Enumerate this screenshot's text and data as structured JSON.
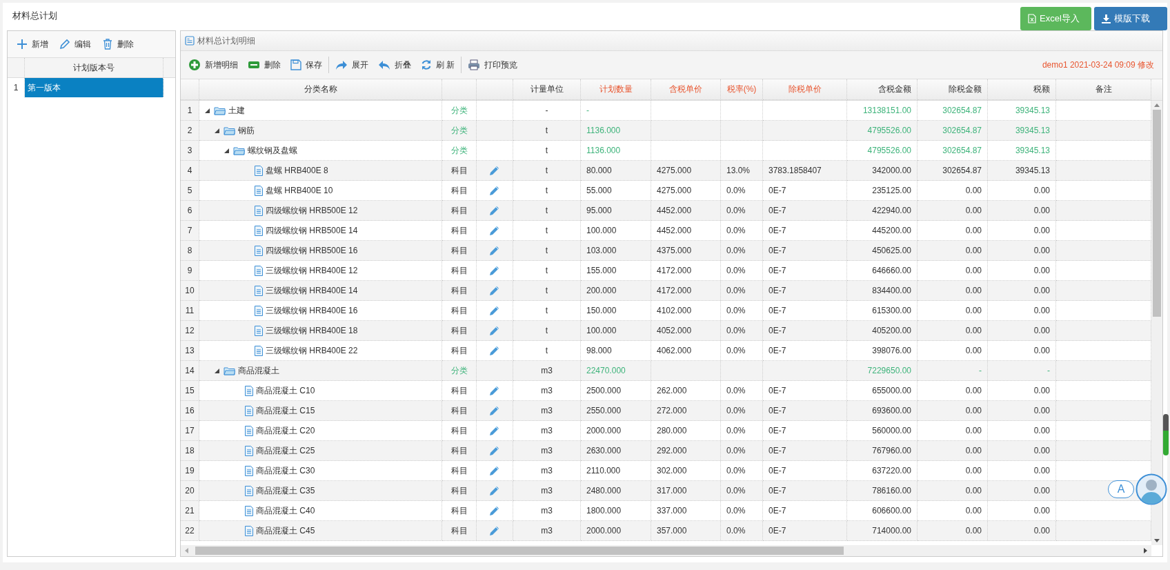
{
  "page": {
    "title": "材料总计划"
  },
  "header_buttons": [
    {
      "kind": "excel",
      "label": "Excel导入"
    },
    {
      "kind": "download",
      "label": "模版下载"
    }
  ],
  "versions_panel": {
    "toolbar": [
      {
        "kind": "add",
        "label": "新增"
      },
      {
        "kind": "edit",
        "label": "编辑"
      },
      {
        "kind": "delete",
        "label": "删除"
      }
    ],
    "column": "计划版本号",
    "rows": [
      {
        "num": "1",
        "name": "第一版本",
        "selected": true
      }
    ]
  },
  "detail_panel": {
    "title": "材料总计划明细",
    "toolbar": [
      {
        "kind": "add",
        "label": "新增明细"
      },
      {
        "kind": "remove",
        "label": "删除"
      },
      {
        "kind": "save",
        "label": "保存"
      },
      {
        "kind": "expand",
        "label": "展开"
      },
      {
        "kind": "collapse",
        "label": "折叠"
      },
      {
        "kind": "refresh",
        "label": "刷 新"
      },
      {
        "kind": "print",
        "label": "打印预览"
      }
    ],
    "modified_note": "demo1 2021-03-24 09:09 修改",
    "columns": [
      {
        "label": "分类名称",
        "editable": false
      },
      {
        "label": "计量单位",
        "editable": false
      },
      {
        "label": "计划数量",
        "editable": true
      },
      {
        "label": "含税单价",
        "editable": true
      },
      {
        "label": "税率(%)",
        "editable": true
      },
      {
        "label": "除税单价",
        "editable": true
      },
      {
        "label": "含税金额",
        "editable": false
      },
      {
        "label": "除税金额",
        "editable": false
      },
      {
        "label": "税额",
        "editable": false
      },
      {
        "label": "备注",
        "editable": false
      }
    ],
    "rows": [
      {
        "num": "1",
        "name": "土建",
        "kind": "category",
        "type": "分类",
        "expanded": true,
        "unit": "-",
        "qty": "-",
        "total": "13138151.00",
        "excl": "302654.87",
        "tax": "39345.13",
        "children": [
          {
            "num": "2",
            "name": "钢筋",
            "kind": "category",
            "type": "分类",
            "expanded": true,
            "unit": "t",
            "qty": "1136.000",
            "total": "4795526.00",
            "excl": "302654.87",
            "tax": "39345.13",
            "children": [
              {
                "num": "3",
                "name": "螺纹钢及盘螺",
                "kind": "category",
                "type": "分类",
                "expanded": true,
                "unit": "t",
                "qty": "1136.000",
                "total": "4795526.00",
                "excl": "302654.87",
                "tax": "39345.13",
                "children": [
                  {
                    "num": "4",
                    "name": "盘螺 HRB400E 8",
                    "kind": "item",
                    "type": "科目",
                    "unit": "t",
                    "qty": "80.000",
                    "price": "4275.000",
                    "rate": "13.0%",
                    "pretax": "3783.1858407",
                    "total": "342000.00",
                    "excl": "302654.87",
                    "tax": "39345.13"
                  },
                  {
                    "num": "5",
                    "name": "盘螺 HRB400E 10",
                    "kind": "item",
                    "type": "科目",
                    "unit": "t",
                    "qty": "55.000",
                    "price": "4275.000",
                    "rate": "0.0%",
                    "pretax": "0E-7",
                    "total": "235125.00",
                    "excl": "0.00",
                    "tax": "0.00"
                  },
                  {
                    "num": "6",
                    "name": "四级螺纹钢 HRB500E 12",
                    "kind": "item",
                    "type": "科目",
                    "unit": "t",
                    "qty": "95.000",
                    "price": "4452.000",
                    "rate": "0.0%",
                    "pretax": "0E-7",
                    "total": "422940.00",
                    "excl": "0.00",
                    "tax": "0.00"
                  },
                  {
                    "num": "7",
                    "name": "四级螺纹钢 HRB500E 14",
                    "kind": "item",
                    "type": "科目",
                    "unit": "t",
                    "qty": "100.000",
                    "price": "4452.000",
                    "rate": "0.0%",
                    "pretax": "0E-7",
                    "total": "445200.00",
                    "excl": "0.00",
                    "tax": "0.00"
                  },
                  {
                    "num": "8",
                    "name": "四级螺纹钢 HRB500E 16",
                    "kind": "item",
                    "type": "科目",
                    "unit": "t",
                    "qty": "103.000",
                    "price": "4375.000",
                    "rate": "0.0%",
                    "pretax": "0E-7",
                    "total": "450625.00",
                    "excl": "0.00",
                    "tax": "0.00"
                  },
                  {
                    "num": "9",
                    "name": "三级螺纹钢 HRB400E 12",
                    "kind": "item",
                    "type": "科目",
                    "unit": "t",
                    "qty": "155.000",
                    "price": "4172.000",
                    "rate": "0.0%",
                    "pretax": "0E-7",
                    "total": "646660.00",
                    "excl": "0.00",
                    "tax": "0.00"
                  },
                  {
                    "num": "10",
                    "name": "三级螺纹钢 HRB400E 14",
                    "kind": "item",
                    "type": "科目",
                    "unit": "t",
                    "qty": "200.000",
                    "price": "4172.000",
                    "rate": "0.0%",
                    "pretax": "0E-7",
                    "total": "834400.00",
                    "excl": "0.00",
                    "tax": "0.00"
                  },
                  {
                    "num": "11",
                    "name": "三级螺纹钢 HRB400E 16",
                    "kind": "item",
                    "type": "科目",
                    "unit": "t",
                    "qty": "150.000",
                    "price": "4102.000",
                    "rate": "0.0%",
                    "pretax": "0E-7",
                    "total": "615300.00",
                    "excl": "0.00",
                    "tax": "0.00"
                  },
                  {
                    "num": "12",
                    "name": "三级螺纹钢 HRB400E 18",
                    "kind": "item",
                    "type": "科目",
                    "unit": "t",
                    "qty": "100.000",
                    "price": "4052.000",
                    "rate": "0.0%",
                    "pretax": "0E-7",
                    "total": "405200.00",
                    "excl": "0.00",
                    "tax": "0.00"
                  },
                  {
                    "num": "13",
                    "name": "三级螺纹钢 HRB400E 22",
                    "kind": "item",
                    "type": "科目",
                    "unit": "t",
                    "qty": "98.000",
                    "price": "4062.000",
                    "rate": "0.0%",
                    "pretax": "0E-7",
                    "total": "398076.00",
                    "excl": "0.00",
                    "tax": "0.00"
                  }
                ]
              }
            ]
          },
          {
            "num": "14",
            "name": "商品混凝土",
            "kind": "category",
            "type": "分类",
            "expanded": true,
            "unit": "m3",
            "qty": "22470.000",
            "total": "7229650.00",
            "excl": "-",
            "tax": "-",
            "children": [
              {
                "num": "15",
                "name": "商品混凝土 C10",
                "kind": "item",
                "type": "科目",
                "unit": "m3",
                "qty": "2500.000",
                "price": "262.000",
                "rate": "0.0%",
                "pretax": "0E-7",
                "total": "655000.00",
                "excl": "0.00",
                "tax": "0.00"
              },
              {
                "num": "16",
                "name": "商品混凝土 C15",
                "kind": "item",
                "type": "科目",
                "unit": "m3",
                "qty": "2550.000",
                "price": "272.000",
                "rate": "0.0%",
                "pretax": "0E-7",
                "total": "693600.00",
                "excl": "0.00",
                "tax": "0.00"
              },
              {
                "num": "17",
                "name": "商品混凝土 C20",
                "kind": "item",
                "type": "科目",
                "unit": "m3",
                "qty": "2000.000",
                "price": "280.000",
                "rate": "0.0%",
                "pretax": "0E-7",
                "total": "560000.00",
                "excl": "0.00",
                "tax": "0.00"
              },
              {
                "num": "18",
                "name": "商品混凝土 C25",
                "kind": "item",
                "type": "科目",
                "unit": "m3",
                "qty": "2630.000",
                "price": "292.000",
                "rate": "0.0%",
                "pretax": "0E-7",
                "total": "767960.00",
                "excl": "0.00",
                "tax": "0.00"
              },
              {
                "num": "19",
                "name": "商品混凝土 C30",
                "kind": "item",
                "type": "科目",
                "unit": "m3",
                "qty": "2110.000",
                "price": "302.000",
                "rate": "0.0%",
                "pretax": "0E-7",
                "total": "637220.00",
                "excl": "0.00",
                "tax": "0.00"
              },
              {
                "num": "20",
                "name": "商品混凝土 C35",
                "kind": "item",
                "type": "科目",
                "unit": "m3",
                "qty": "2480.000",
                "price": "317.000",
                "rate": "0.0%",
                "pretax": "0E-7",
                "total": "786160.00",
                "excl": "0.00",
                "tax": "0.00"
              },
              {
                "num": "21",
                "name": "商品混凝土 C40",
                "kind": "item",
                "type": "科目",
                "unit": "m3",
                "qty": "1800.000",
                "price": "337.000",
                "rate": "0.0%",
                "pretax": "0E-7",
                "total": "606600.00",
                "excl": "0.00",
                "tax": "0.00"
              },
              {
                "num": "22",
                "name": "商品混凝土 C45",
                "kind": "item",
                "type": "科目",
                "unit": "m3",
                "qty": "2000.000",
                "price": "357.000",
                "rate": "0.0%",
                "pretax": "0E-7",
                "total": "714000.00",
                "excl": "0.00",
                "tax": "0.00"
              }
            ]
          }
        ]
      }
    ]
  },
  "assistant_widget": {
    "label": "A"
  }
}
